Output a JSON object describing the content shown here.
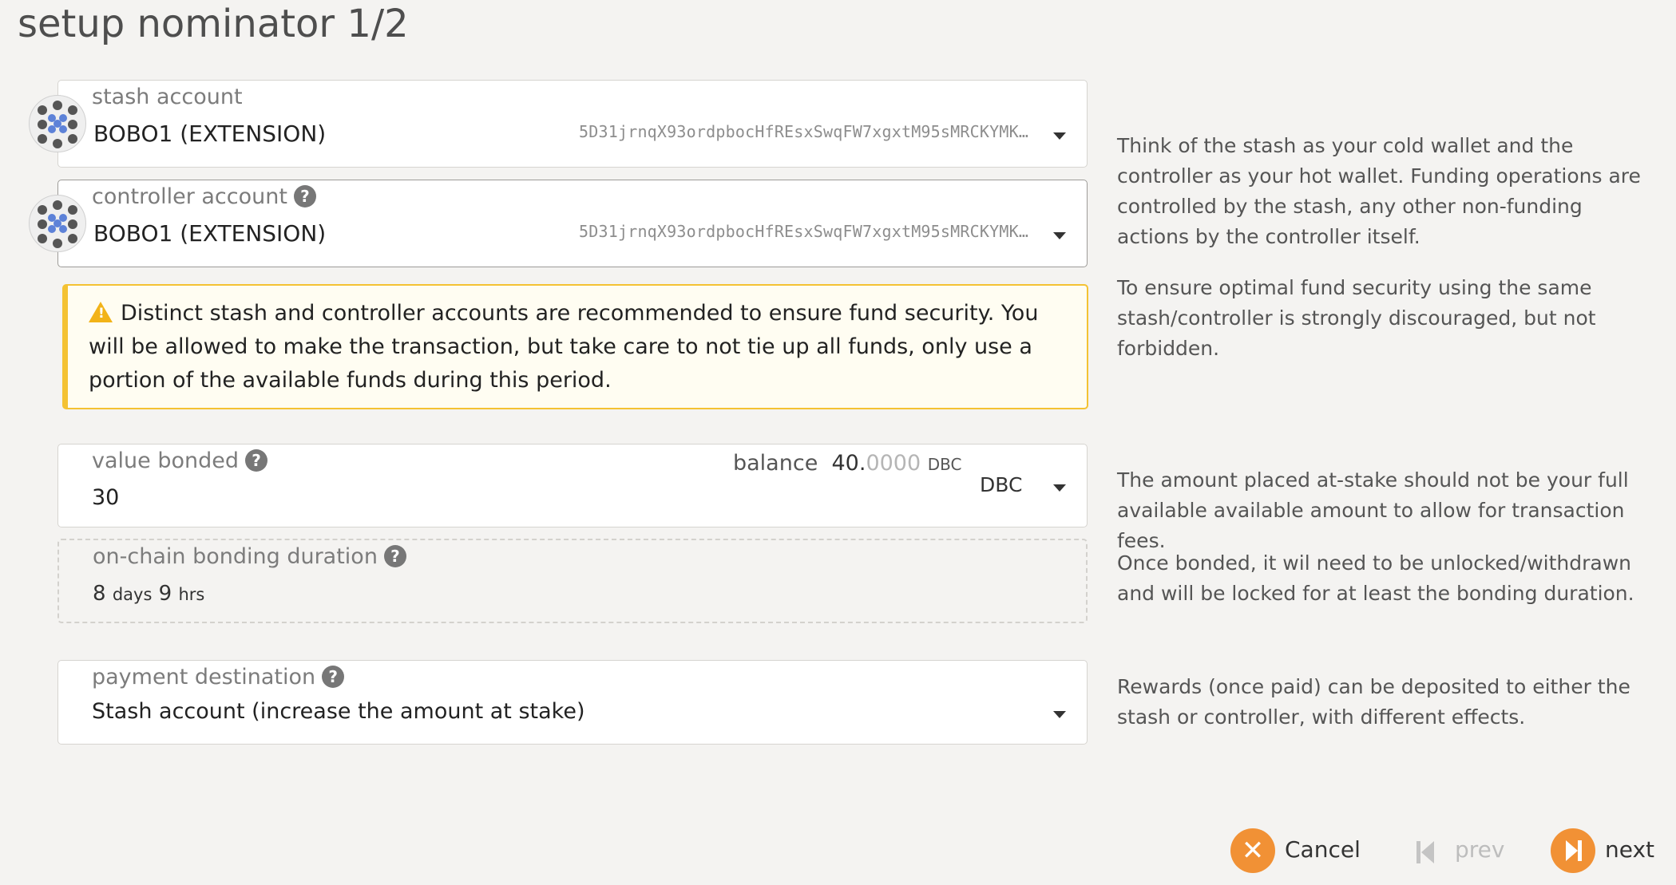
{
  "page": {
    "title": "setup nominator 1/2"
  },
  "stash": {
    "label": "stash account",
    "name": "BOBO1 (EXTENSION)",
    "address": "5D31jrnqX93ordpbocHfREsxSwqFW7xgxtM95sMRCKYMK…"
  },
  "controller": {
    "label": "controller account",
    "name": "BOBO1 (EXTENSION)",
    "address": "5D31jrnqX93ordpbocHfREsxSwqFW7xgxtM95sMRCKYMK…"
  },
  "warning": {
    "text": "Distinct stash and controller accounts are recommended to ensure fund security. You will be allowed to make the transaction, but take care to not tie up all funds, only use a portion of the available funds during this period."
  },
  "value_bonded": {
    "label": "value bonded",
    "value": "30",
    "balance_label": "balance",
    "balance_int": "40.",
    "balance_dec": "0000",
    "balance_unit": "DBC",
    "unit": "DBC"
  },
  "bonding_duration": {
    "label": "on-chain bonding duration",
    "days_num": "8",
    "days_unit": "days",
    "hrs_num": "9",
    "hrs_unit": "hrs"
  },
  "payment_destination": {
    "label": "payment destination",
    "value": "Stash account (increase the amount at stake)"
  },
  "help": {
    "stash_controller": "Think of the stash as your cold wallet and the controller as your hot wallet. Funding operations are controlled by the stash, any other non-funding actions by the controller itself.",
    "security": "To ensure optimal fund security using the same stash/controller is strongly discouraged, but not forbidden.",
    "amount": "The amount placed at-stake should not be your full available available amount to allow for transaction fees.",
    "bonded": "Once bonded, it wil need to be unlocked/withdrawn and will be locked for at least the bonding duration.",
    "rewards": "Rewards (once paid) can be deposited to either the stash or controller, with different effects."
  },
  "buttons": {
    "cancel": "Cancel",
    "prev": "prev",
    "next": "next"
  },
  "colors": {
    "accent": "#f19135",
    "warning_border": "#f4c233",
    "warning_bg": "#fffdf2",
    "avatar_dot": "#5d82d8"
  },
  "icons": [
    "identicon-avatar",
    "help-icon",
    "warning-icon",
    "chevron-down-icon",
    "close-icon",
    "skip-back-icon",
    "skip-forward-icon"
  ]
}
